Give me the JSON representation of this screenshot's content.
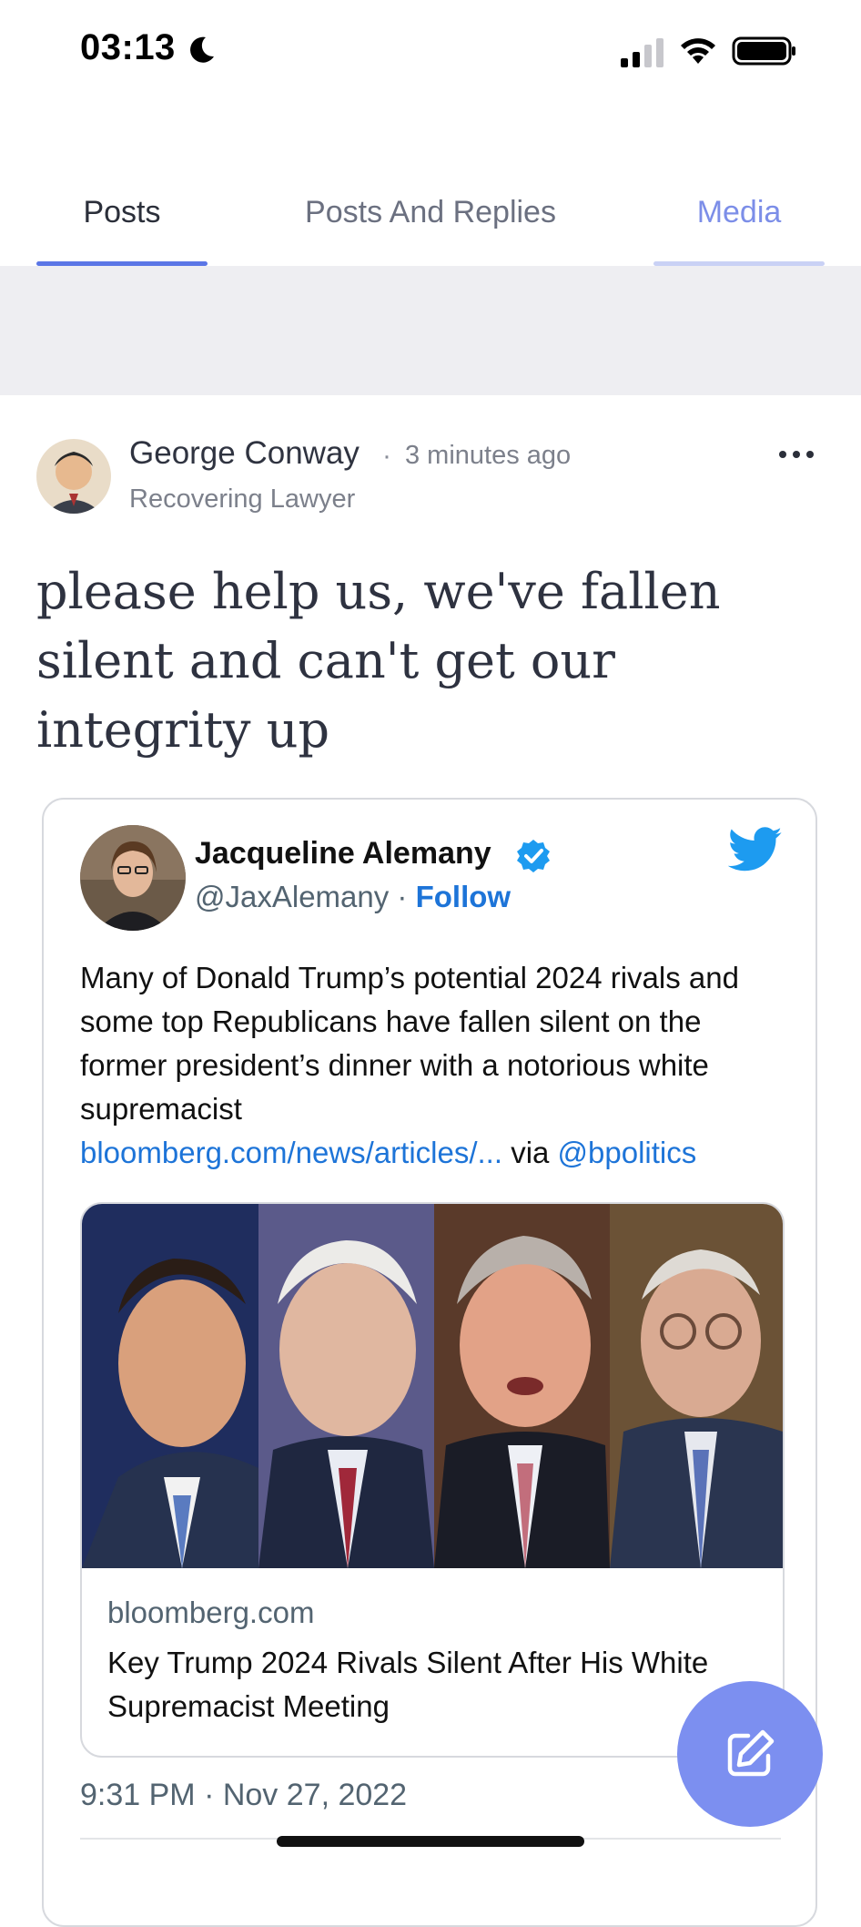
{
  "status_bar": {
    "time": "03:13"
  },
  "tabs": [
    {
      "label": "Posts",
      "active": true
    },
    {
      "label": "Posts And Replies",
      "active": false
    },
    {
      "label": "Media",
      "active": false
    }
  ],
  "post": {
    "author_name": "George Conway",
    "separator": "·",
    "time_ago": "3 minutes ago",
    "author_bio": "Recovering Lawyer",
    "text": "please help us, we've fallen silent and can't get our integrity up"
  },
  "embedded_tweet": {
    "name": "Jacqueline Alemany",
    "handle": "@JaxAlemany",
    "separator": "·",
    "follow_label": "Follow",
    "text": "Many of Donald Trump’s potential 2024 rivals and some top Republicans have fallen silent on the former president’s dinner with a notorious white supremacist",
    "link_text": "bloomberg.com/news/articles/...",
    "via": "via",
    "via_handle": "@bpolitics",
    "link_card": {
      "domain": "bloomberg.com",
      "title": "Key Trump 2024 Rivals Silent After His White Supremacist Meeting"
    },
    "timestamp": "9:31 PM · Nov 27, 2022"
  },
  "colors": {
    "accent": "#5b76e6",
    "fab": "#7c8ff0",
    "twitter_blue": "#1d9bf0",
    "link": "#1d74d8"
  },
  "icons": {
    "moon": "moon-icon",
    "signal": "cellular-signal-icon",
    "wifi": "wifi-icon",
    "battery": "battery-icon",
    "more": "more-horizontal-icon",
    "verified": "verified-badge-icon",
    "twitter": "twitter-bird-icon",
    "compose": "compose-icon"
  }
}
